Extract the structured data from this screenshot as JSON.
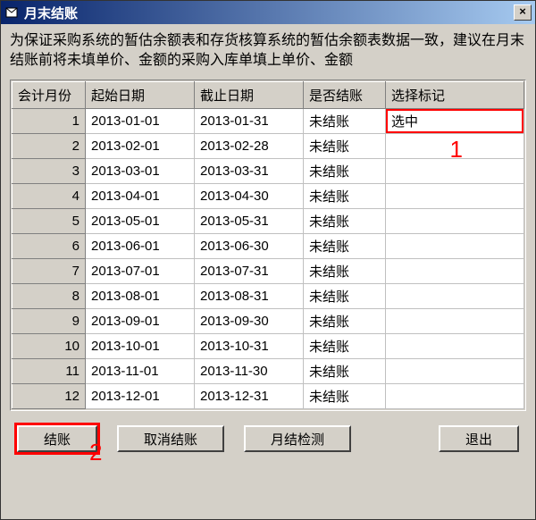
{
  "window": {
    "title": "月末结账"
  },
  "instruction": "为保证采购系统的暂估余额表和存货核算系统的暂估余额表数据一致，建议在月末结账前将未填单价、金额的采购入库单填上单价、金额",
  "columns": {
    "month": "会计月份",
    "start": "起始日期",
    "end": "截止日期",
    "status": "是否结账",
    "select": "选择标记"
  },
  "rows": [
    {
      "m": "1",
      "s": "2013-01-01",
      "e": "2013-01-31",
      "st": "未结账",
      "sel": "选中"
    },
    {
      "m": "2",
      "s": "2013-02-01",
      "e": "2013-02-28",
      "st": "未结账",
      "sel": ""
    },
    {
      "m": "3",
      "s": "2013-03-01",
      "e": "2013-03-31",
      "st": "未结账",
      "sel": ""
    },
    {
      "m": "4",
      "s": "2013-04-01",
      "e": "2013-04-30",
      "st": "未结账",
      "sel": ""
    },
    {
      "m": "5",
      "s": "2013-05-01",
      "e": "2013-05-31",
      "st": "未结账",
      "sel": ""
    },
    {
      "m": "6",
      "s": "2013-06-01",
      "e": "2013-06-30",
      "st": "未结账",
      "sel": ""
    },
    {
      "m": "7",
      "s": "2013-07-01",
      "e": "2013-07-31",
      "st": "未结账",
      "sel": ""
    },
    {
      "m": "8",
      "s": "2013-08-01",
      "e": "2013-08-31",
      "st": "未结账",
      "sel": ""
    },
    {
      "m": "9",
      "s": "2013-09-01",
      "e": "2013-09-30",
      "st": "未结账",
      "sel": ""
    },
    {
      "m": "10",
      "s": "2013-10-01",
      "e": "2013-10-31",
      "st": "未结账",
      "sel": ""
    },
    {
      "m": "11",
      "s": "2013-11-01",
      "e": "2013-11-30",
      "st": "未结账",
      "sel": ""
    },
    {
      "m": "12",
      "s": "2013-12-01",
      "e": "2013-12-31",
      "st": "未结账",
      "sel": ""
    }
  ],
  "buttons": {
    "close": "结账",
    "cancel": "取消结账",
    "check": "月结检测",
    "exit": "退出"
  },
  "annotations": {
    "a1": "1",
    "a2": "2"
  }
}
